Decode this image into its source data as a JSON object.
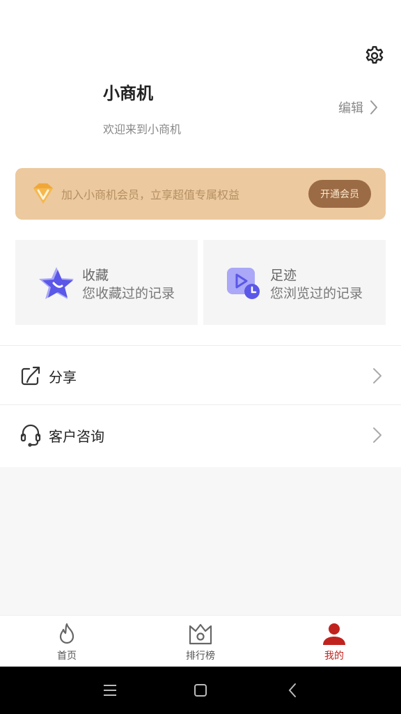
{
  "profile": {
    "name": "小商机",
    "welcome": "欢迎来到小商机",
    "edit_label": "编辑"
  },
  "vip": {
    "text": "加入小商机会员，立享超值专属权益",
    "button_label": "开通会员"
  },
  "cards": [
    {
      "title": "收藏",
      "subtitle": "您收藏过的记录",
      "icon": "star-icon"
    },
    {
      "title": "足迹",
      "subtitle": "您浏览过的记录",
      "icon": "history-play-icon"
    }
  ],
  "menu": [
    {
      "label": "分享",
      "icon": "share-icon"
    },
    {
      "label": "客户咨询",
      "icon": "headset-icon"
    }
  ],
  "tabs": [
    {
      "label": "首页",
      "icon": "flame-icon",
      "active": false
    },
    {
      "label": "排行榜",
      "icon": "crown-camera-icon",
      "active": false
    },
    {
      "label": "我的",
      "icon": "user-icon",
      "active": true
    }
  ],
  "colors": {
    "accent": "#c0231e",
    "vip_bg": "#ecc99e",
    "vip_button": "#9b6b45",
    "card_icon": "#5b57e8"
  }
}
